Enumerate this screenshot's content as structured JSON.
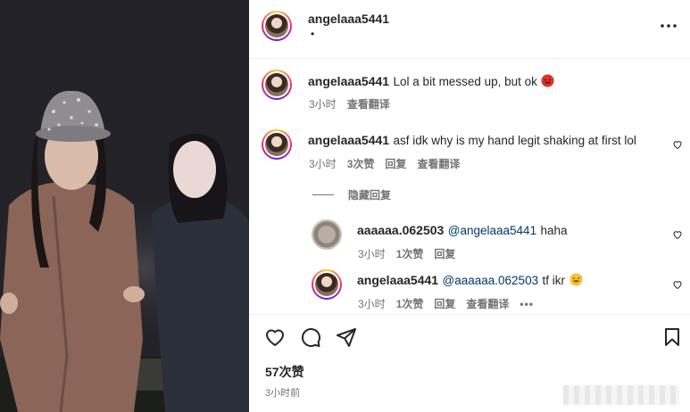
{
  "header": {
    "username": "angelaaa5441",
    "subtitle": "•"
  },
  "caption": {
    "username": "angelaaa5441",
    "text": "Lol a bit messed up, but ok",
    "time": "3小时",
    "translate": "查看翻译"
  },
  "comment1": {
    "username": "angelaaa5441",
    "text": "asf idk why is my hand legit shaking at first lol",
    "time": "3小时",
    "likes": "3次赞",
    "reply": "回复",
    "translate": "查看翻译"
  },
  "hide_replies": "隐藏回复",
  "reply1": {
    "username": "aaaaaa.062503",
    "mention": "@angelaaa5441",
    "text": "haha",
    "time": "3小时",
    "likes": "1次赞",
    "reply": "回复"
  },
  "reply2": {
    "username": "angelaaa5441",
    "mention": "@aaaaaa.062503",
    "text": "tf ikr",
    "time": "3小时",
    "likes": "1次赞",
    "reply": "回复",
    "translate": "查看翻译",
    "more": "•••"
  },
  "footer": {
    "likes": "57次赞",
    "time": "3小时前"
  },
  "icons": {
    "more": "more-horizontal-icon",
    "like": "heart-icon",
    "comment": "comment-icon",
    "share": "send-icon",
    "save": "bookmark-icon"
  }
}
